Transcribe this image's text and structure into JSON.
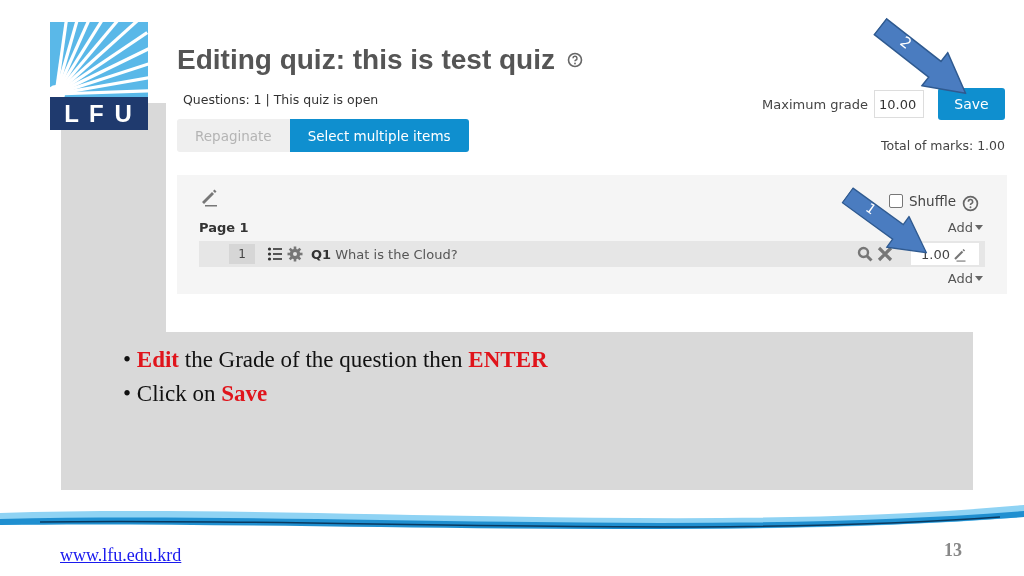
{
  "logo": {
    "text": "L F U"
  },
  "quiz": {
    "title": "Editing quiz: this is test quiz",
    "summary": "Questions: 1 | This quiz is open",
    "buttons": [
      {
        "label": "Repaginate",
        "disabled": true
      },
      {
        "label": "Select multiple items",
        "disabled": false
      }
    ],
    "max_grade": {
      "label": "Maximum grade",
      "value": "10.00"
    },
    "save": "Save",
    "total": "Total of marks: 1.00",
    "shuffle": {
      "label": "Shuffle",
      "checked": false
    },
    "page": {
      "title": "Page 1",
      "add": "Add"
    },
    "questions": [
      {
        "number": "1",
        "id": "Q1",
        "text": "What is the Cloud?",
        "mark": "1.00"
      }
    ],
    "add_bottom": "Add"
  },
  "callouts": [
    {
      "number": "2"
    },
    {
      "number": "1"
    }
  ],
  "bullets": [
    "• **Edit** the Grade of the question then **ENTER**",
    "• Click on **Save**"
  ],
  "footer": {
    "url": "www.lfu.edu.krd",
    "page": "13"
  }
}
